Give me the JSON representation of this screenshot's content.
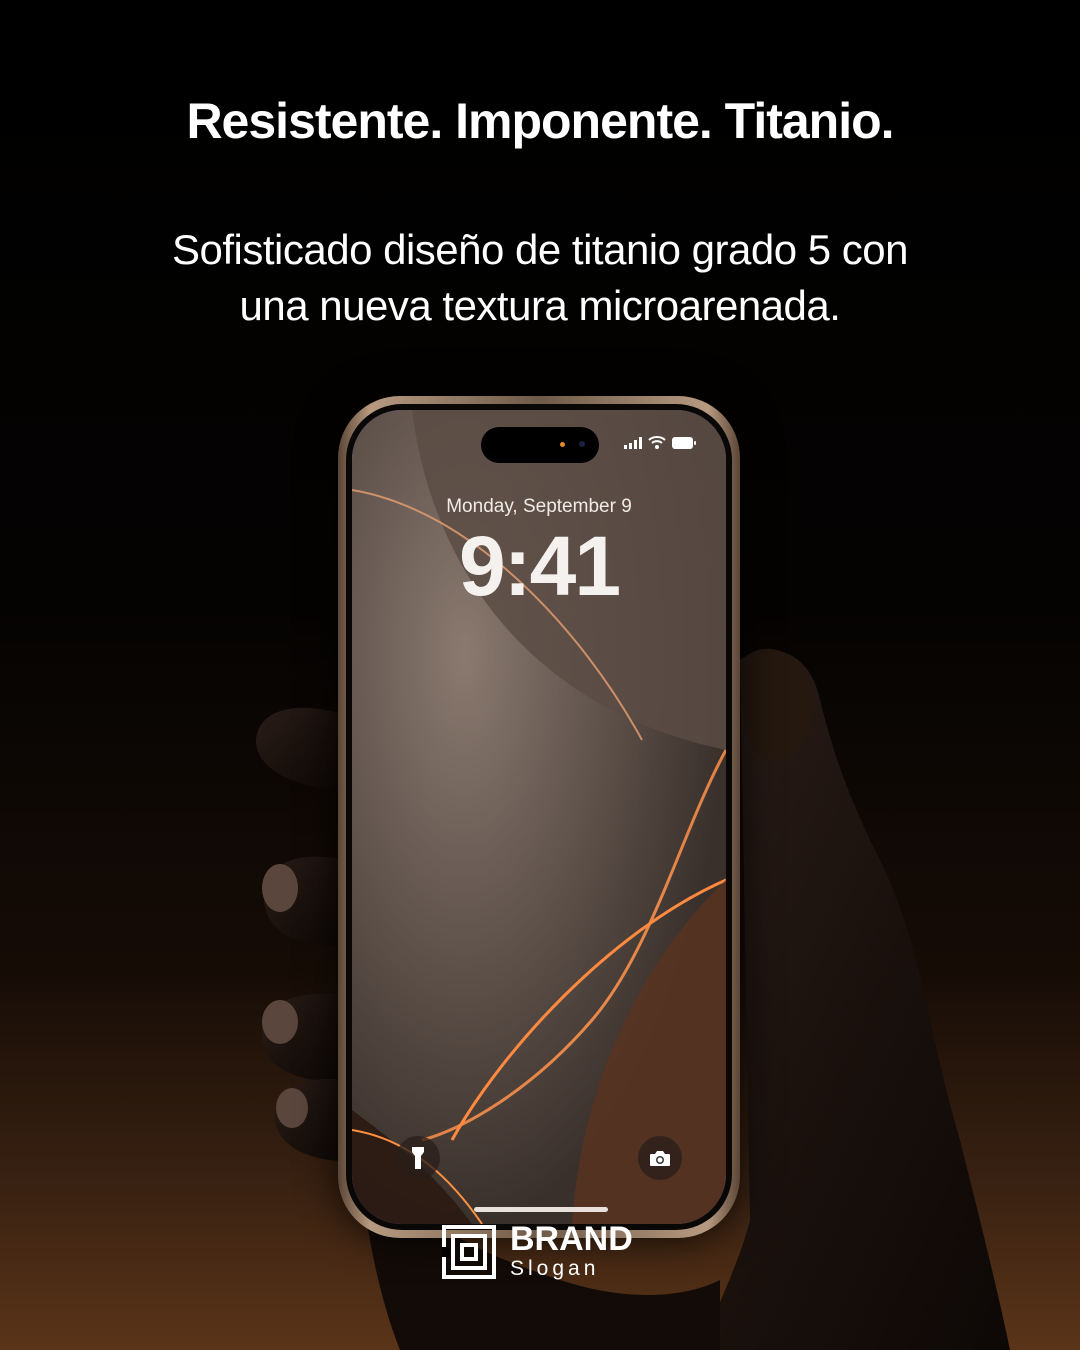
{
  "headline": "Resistente. Imponente. Titanio.",
  "subline": [
    "Sofisticado diseño de titanio grado 5 con",
    "una nueva textura microarenada."
  ],
  "lockscreen": {
    "date": "Monday, September 9",
    "time": "9:41",
    "icons": [
      "signal-icon",
      "wifi-icon",
      "battery-icon",
      "flashlight-icon",
      "camera-icon"
    ]
  },
  "brand": {
    "name": "BRAND",
    "slogan": "Slogan"
  },
  "colors": {
    "background_top": "#000000",
    "background_bottom": "#5a3418",
    "screen_glow": "#b478ff",
    "accent_orange": "#e48a2a"
  }
}
